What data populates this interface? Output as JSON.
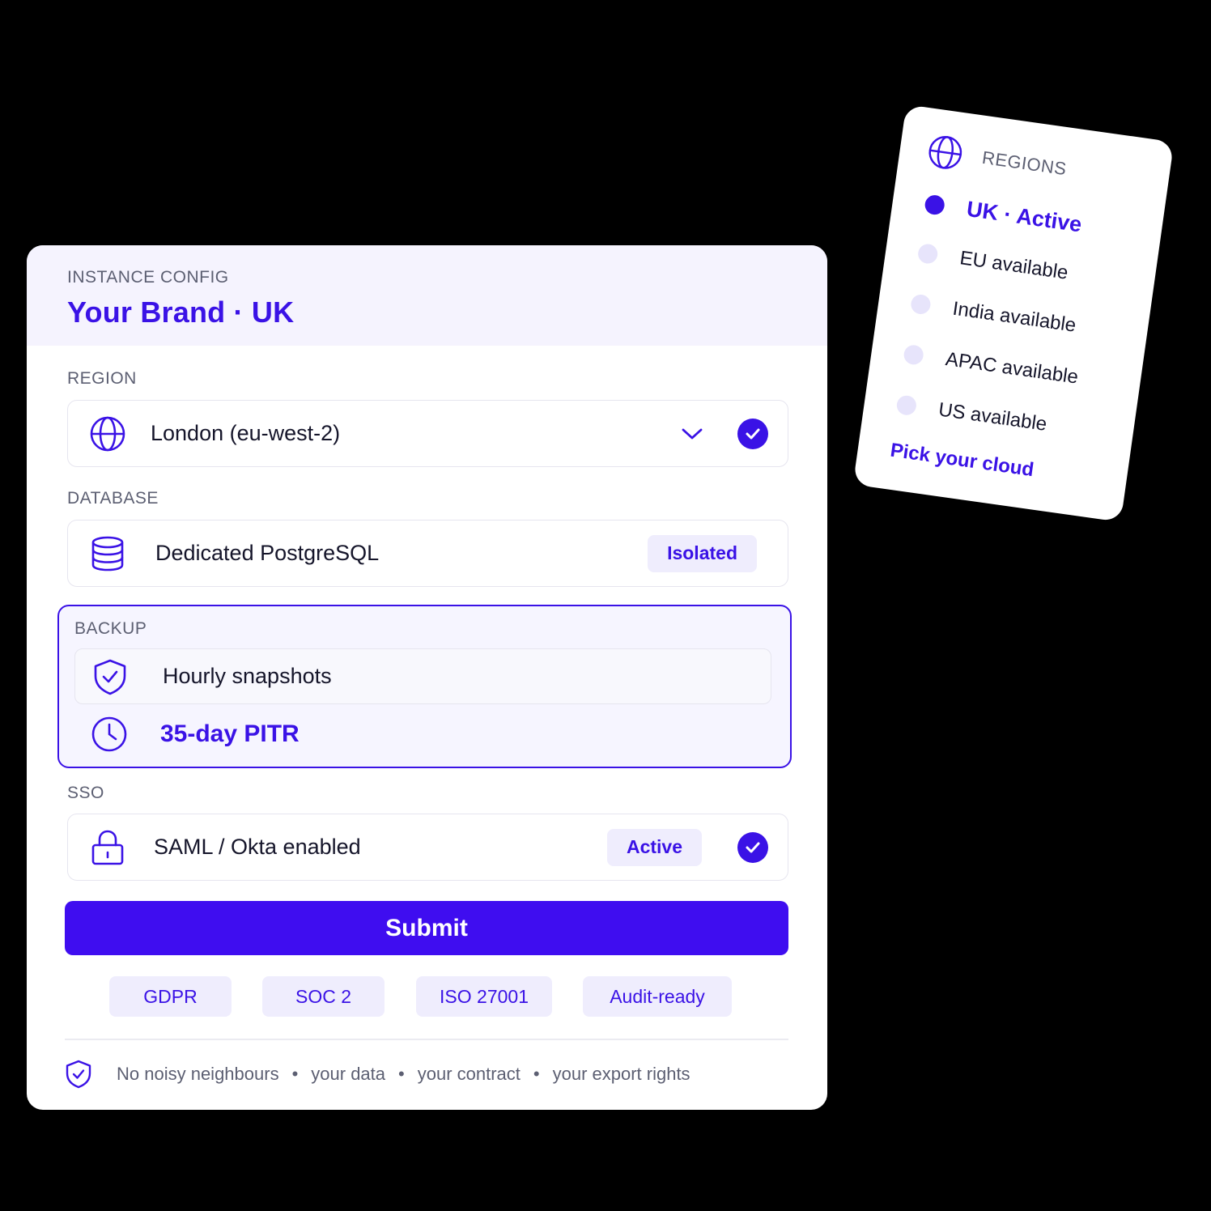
{
  "colors": {
    "accent": "#3a12e6",
    "submit_bg": "#3f0df0",
    "pill_bg": "#efedfd",
    "header_bg": "#f5f3fe"
  },
  "header": {
    "eyebrow": "INSTANCE CONFIG",
    "title": "Your Brand · UK"
  },
  "region": {
    "label": "REGION",
    "value": "London (eu-west-2)",
    "icon": "globe-icon"
  },
  "database": {
    "label": "DATABASE",
    "value": "Dedicated PostgreSQL",
    "badge": "Isolated",
    "icon": "database-icon"
  },
  "backup": {
    "label": "BACKUP",
    "snapshots": "Hourly snapshots",
    "pitr": "35-day PITR"
  },
  "sso": {
    "label": "SSO",
    "value": "SAML / Okta enabled",
    "badge": "Active",
    "icon": "lock-icon"
  },
  "submit_label": "Submit",
  "badges": [
    "GDPR",
    "SOC 2",
    "ISO 27001",
    "Audit-ready"
  ],
  "footer": {
    "items": [
      "No noisy neighbours",
      "your data",
      "your contract",
      "your export rights"
    ],
    "separator": "•"
  },
  "regions_card": {
    "title": "REGIONS",
    "items": [
      {
        "label": "UK · Active",
        "active": true
      },
      {
        "label": "EU available",
        "active": false
      },
      {
        "label": "India available",
        "active": false
      },
      {
        "label": "APAC available",
        "active": false
      },
      {
        "label": "US available",
        "active": false
      }
    ],
    "link": "Pick your cloud"
  }
}
